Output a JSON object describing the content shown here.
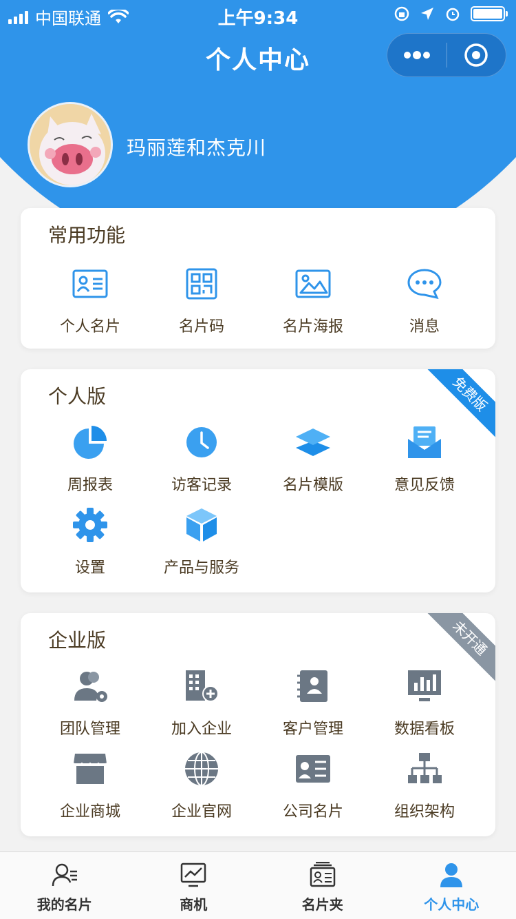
{
  "status_bar": {
    "carrier": "中国联通",
    "time": "上午9:34"
  },
  "nav": {
    "title": "个人中心"
  },
  "profile": {
    "name": "玛丽莲和杰克川"
  },
  "common": {
    "title": "常用功能",
    "items": [
      {
        "label": "个人名片",
        "icon": "contact-card-icon"
      },
      {
        "label": "名片码",
        "icon": "qr-code-icon"
      },
      {
        "label": "名片海报",
        "icon": "image-poster-icon"
      },
      {
        "label": "消息",
        "icon": "message-bubble-icon"
      }
    ]
  },
  "personal": {
    "title": "个人版",
    "badge": "免费版",
    "items": [
      {
        "label": "周报表",
        "icon": "pie-chart-icon"
      },
      {
        "label": "访客记录",
        "icon": "clock-icon"
      },
      {
        "label": "名片模版",
        "icon": "layers-icon"
      },
      {
        "label": "意见反馈",
        "icon": "mail-feedback-icon"
      },
      {
        "label": "设置",
        "icon": "gear-icon"
      },
      {
        "label": "产品与服务",
        "icon": "cube-icon"
      }
    ]
  },
  "enterprise": {
    "title": "企业版",
    "badge": "未开通",
    "items": [
      {
        "label": "团队管理",
        "icon": "team-gear-icon"
      },
      {
        "label": "加入企业",
        "icon": "building-plus-icon"
      },
      {
        "label": "客户管理",
        "icon": "contact-book-icon"
      },
      {
        "label": "数据看板",
        "icon": "dashboard-icon"
      },
      {
        "label": "企业商城",
        "icon": "store-icon"
      },
      {
        "label": "企业官网",
        "icon": "globe-icon"
      },
      {
        "label": "公司名片",
        "icon": "company-card-icon"
      },
      {
        "label": "组织架构",
        "icon": "org-chart-icon"
      }
    ]
  },
  "tabbar": {
    "tabs": [
      {
        "label": "我的名片",
        "icon": "user-card-icon"
      },
      {
        "label": "商机",
        "icon": "trend-chart-icon"
      },
      {
        "label": "名片夹",
        "icon": "card-holder-icon"
      },
      {
        "label": "个人中心",
        "icon": "person-icon",
        "active": true
      }
    ]
  },
  "colors": {
    "primary": "#2f94ea",
    "blue_badge": "#1e8ee8",
    "gray_badge": "#8a96a3",
    "gray_icon": "#6b7784",
    "text": "#4a3a22"
  }
}
